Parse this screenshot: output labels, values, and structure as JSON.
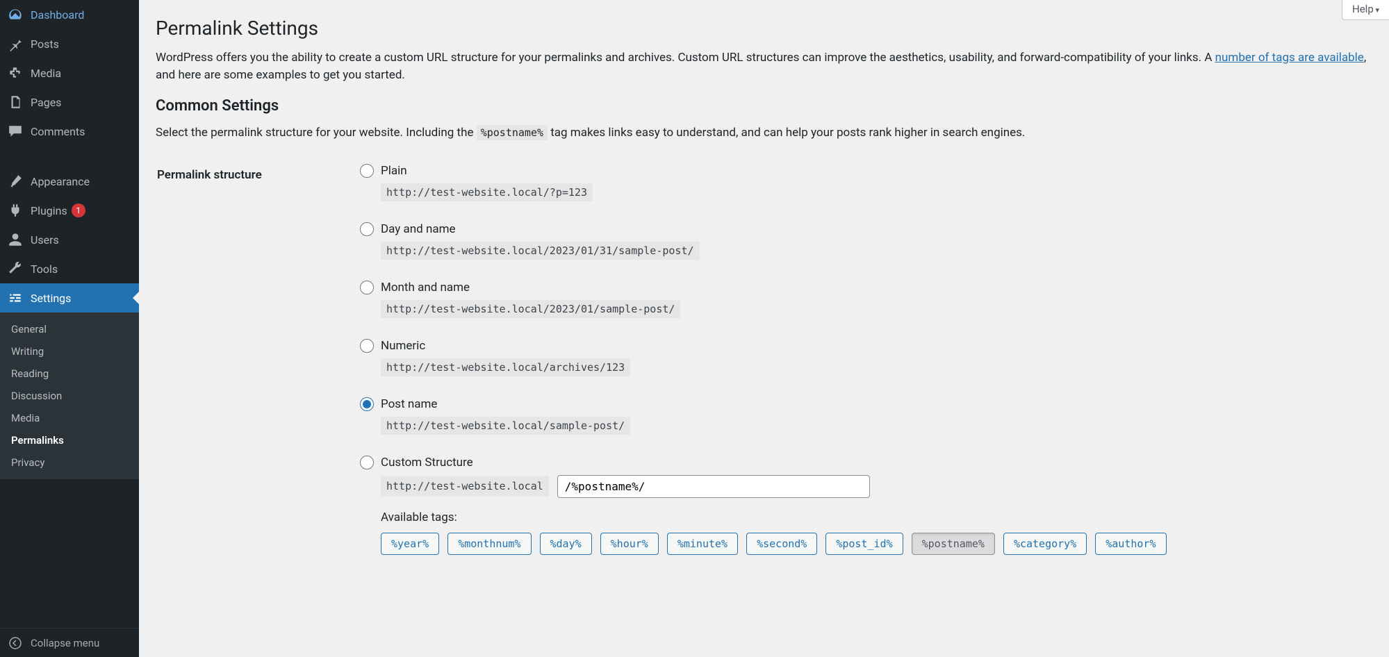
{
  "help_label": "Help",
  "sidebar": {
    "dashboard": "Dashboard",
    "posts": "Posts",
    "media": "Media",
    "pages": "Pages",
    "comments": "Comments",
    "appearance": "Appearance",
    "plugins": "Plugins",
    "plugins_badge": "1",
    "users": "Users",
    "tools": "Tools",
    "settings": "Settings",
    "collapse": "Collapse menu",
    "submenu": {
      "general": "General",
      "writing": "Writing",
      "reading": "Reading",
      "discussion": "Discussion",
      "media": "Media",
      "permalinks": "Permalinks",
      "privacy": "Privacy"
    }
  },
  "page": {
    "title": "Permalink Settings",
    "intro_1": "WordPress offers you the ability to create a custom URL structure for your permalinks and archives. Custom URL structures can improve the aesthetics, usability, and forward-compatibility of your links. A ",
    "intro_link": "number of tags are available",
    "intro_2": ", and here are some examples to get you started.",
    "common_heading": "Common Settings",
    "common_p1": "Select the permalink structure for your website. Including the ",
    "common_code": "%postname%",
    "common_p2": " tag makes links easy to understand, and can help your posts rank higher in search engines.",
    "structure_label": "Permalink structure",
    "options": {
      "plain": {
        "label": "Plain",
        "example": "http://test-website.local/?p=123"
      },
      "day": {
        "label": "Day and name",
        "example": "http://test-website.local/2023/01/31/sample-post/"
      },
      "month": {
        "label": "Month and name",
        "example": "http://test-website.local/2023/01/sample-post/"
      },
      "numeric": {
        "label": "Numeric",
        "example": "http://test-website.local/archives/123"
      },
      "postname": {
        "label": "Post name",
        "example": "http://test-website.local/sample-post/"
      },
      "custom": {
        "label": "Custom Structure",
        "prefix": "http://test-website.local",
        "value": "/%postname%/"
      }
    },
    "selected": "postname",
    "available_tags_label": "Available tags:",
    "tags": [
      "%year%",
      "%monthnum%",
      "%day%",
      "%hour%",
      "%minute%",
      "%second%",
      "%post_id%",
      "%postname%",
      "%category%",
      "%author%"
    ],
    "active_tag": "%postname%"
  }
}
